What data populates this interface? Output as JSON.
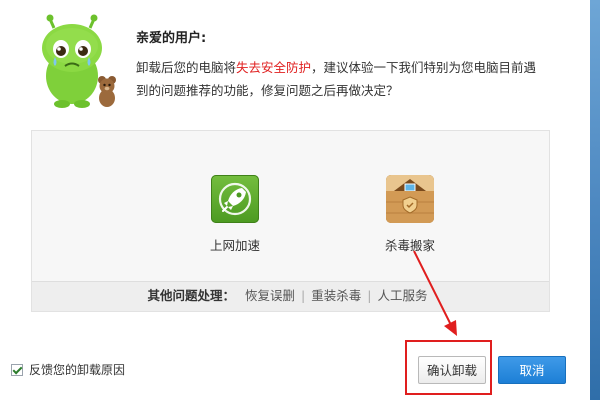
{
  "header": {
    "greeting": "亲爱的用户:",
    "message_part1": "卸载后您的电脑将",
    "message_warn": "失去安全防护",
    "message_part2": "，建议体验一下我们特别为您电脑目前遇到的问题推荐的功能，修复问题之后再做决定？",
    "mascot_icon": "green-mascot-with-teddy-bear"
  },
  "panel": {
    "tools": [
      {
        "label": "上网加速",
        "icon": "rocket-icon"
      },
      {
        "label": "杀毒搬家",
        "icon": "house-box-icon"
      }
    ],
    "links_lead": "其他问题处理：",
    "links": [
      "恢复误删",
      "重装杀毒",
      "人工服务"
    ]
  },
  "footer": {
    "feedback_label": "反馈您的卸载原因",
    "feedback_checked": true,
    "confirm_label": "确认卸载",
    "cancel_label": "取消"
  },
  "colors": {
    "warning_text": "#e02020",
    "cancel_button": "#1d7fd6",
    "highlight": "#e01e1e"
  }
}
